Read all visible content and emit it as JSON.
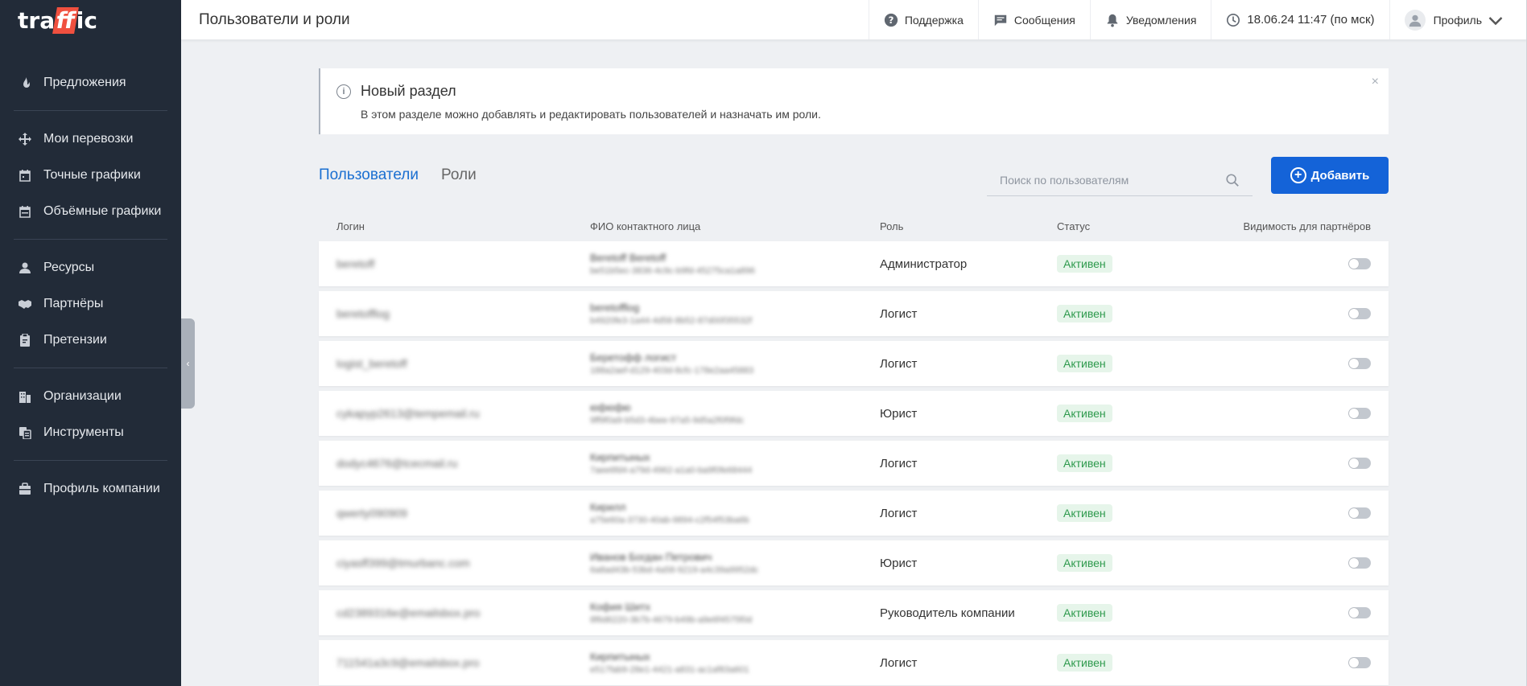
{
  "logo": {
    "text_left": "tra",
    "text_mark": "ff",
    "text_right": "ic"
  },
  "sidebar": {
    "groups": [
      [
        {
          "label": "Предложения",
          "icon": "fire-icon"
        }
      ],
      [
        {
          "label": "Мои перевозки",
          "icon": "arrows-icon"
        },
        {
          "label": "Точные графики",
          "icon": "calendar-icon"
        },
        {
          "label": "Объёмные графики",
          "icon": "calendar-range-icon"
        }
      ],
      [
        {
          "label": "Ресурсы",
          "icon": "person-icon"
        },
        {
          "label": "Партнёры",
          "icon": "handshake-icon"
        },
        {
          "label": "Претензии",
          "icon": "clipboard-icon"
        }
      ],
      [
        {
          "label": "Организации",
          "icon": "building-icon"
        },
        {
          "label": "Инструменты",
          "icon": "tools-icon"
        }
      ],
      [
        {
          "label": "Профиль компании",
          "icon": "briefcase-icon"
        }
      ]
    ],
    "collapse_glyph": "‹"
  },
  "header": {
    "title": "Пользователи и роли",
    "support": "Поддержка",
    "messages": "Сообщения",
    "notifications": "Уведомления",
    "datetime": "18.06.24 11:47 (по мск)",
    "profile": "Профиль"
  },
  "alert": {
    "title": "Новый раздел",
    "text": "В этом разделе можно добавлять и редактировать пользователей и назначать им роли.",
    "close": "×"
  },
  "tabs": [
    {
      "label": "Пользователи",
      "active": true
    },
    {
      "label": "Роли",
      "active": false
    }
  ],
  "search": {
    "placeholder": "Поиск по пользователям",
    "value": ""
  },
  "add_button": {
    "label": "Добавить"
  },
  "table": {
    "columns": [
      "Логин",
      "ФИО контактного лица",
      "Роль",
      "Статус",
      "Видимость для партнёров"
    ],
    "rows": [
      {
        "login": "beretoff",
        "fio": "Beretoff Beretoff",
        "fio_id": "be51b5ec-3836-4c9c-b9fd-45275ca1a896",
        "role": "Администратор",
        "status": "Активен"
      },
      {
        "login": "beretofflog",
        "fio": "beretofflog",
        "fio_id": "b4920fe3-1a44-4d58-8b52-87d00f35532f",
        "role": "Логист",
        "status": "Активен"
      },
      {
        "login": "logist_beretoff",
        "fio": "Беретофф логист",
        "fio_id": "188a2aef-d129-403d-8cfc-178e2aa45883",
        "role": "Логист",
        "status": "Активен"
      },
      {
        "login": "cykapyp2613@tempemail.ru",
        "fio": "юфюфю",
        "fio_id": "9ff9f0a9-b5d3-4bee-97a5-9d5a2f0f9fdc",
        "role": "Юрист",
        "status": "Активен"
      },
      {
        "login": "dodyc4676@tcecmail.ru",
        "fio": "Кирпитыных",
        "fio_id": "7aee6fd4-a79d-4962-a1a0-ba9f0fe68444",
        "role": "Логист",
        "status": "Активен"
      },
      {
        "login": "qwerty090909",
        "fio": "Кирилл",
        "fio_id": "a75e60a-3730-40ab-9894-c2f54f53ba6b",
        "role": "Логист",
        "status": "Активен"
      },
      {
        "login": "ciyasff399@tmurbanc.com",
        "fio": "Иванов Богдан Петрович",
        "fio_id": "6a8ad43b-53bd-4a58-9219-a4c39a9952dc",
        "role": "Юрист",
        "status": "Активен"
      },
      {
        "login": "cd2389316e@emailsbox.pro",
        "fio": "Кофия Шитх",
        "fio_id": "8f6d6220-3b7b-4679-b49b-a9e6f4575f0d",
        "role": "Руководитель компании",
        "status": "Активен"
      },
      {
        "login": "711541a3c9@emailsbox.pro",
        "fio": "Кирпитыных",
        "fio_id": "e517fab9-28e1-4421-a831-ac1af83a601",
        "role": "Логист",
        "status": "Активен"
      }
    ]
  },
  "colors": {
    "sidebar": "#222b38",
    "accent": "#1463d8",
    "status_bg": "#e6f5ea",
    "status_text": "#2e9a4d"
  }
}
